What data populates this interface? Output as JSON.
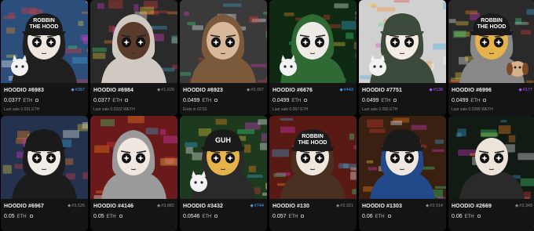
{
  "listing": {
    "cards": [
      {
        "name": "HOODIO #6983",
        "rank": "#367",
        "rank_style": "hl",
        "price": "0.0377",
        "currency": "ETH",
        "sub": "Last sale 0.031 ETH",
        "art": {
          "bg": "#2c4e7a",
          "skin": "#f0e6e0",
          "cap": "#1a1a1a",
          "hood": "#202020",
          "capText": "ROBBIN THE HOOD",
          "pet": "cat"
        }
      },
      {
        "name": "HOODIO #6984",
        "rank": "#1,626",
        "rank_style": "",
        "price": "0.0377",
        "currency": "ETH",
        "sub": "Last sale 0.0322 WETH",
        "art": {
          "bg": "#2a2a2a",
          "skin": "#5a3a2a",
          "cap": "",
          "hood": "#cfc9c2",
          "capText": "",
          "pet": ""
        }
      },
      {
        "name": "HOODIO #6923",
        "rank": "#3,097",
        "rank_style": "",
        "price": "0.0499",
        "currency": "ETH",
        "sub": "Ends in 02:52",
        "art": {
          "bg": "#3a3a3a",
          "skin": "#d9b89a",
          "cap": "",
          "hood": "#7a5a3a",
          "capText": "",
          "pet": ""
        }
      },
      {
        "name": "HOODIO #6676",
        "rank": "#443",
        "rank_style": "hl",
        "price": "0.0499",
        "currency": "ETH",
        "sub": "Last sale 0.057 ETH",
        "art": {
          "bg": "#0e2a12",
          "skin": "#eeeae6",
          "cap": "",
          "hood": "#2f6a35",
          "capText": "",
          "pet": "cat"
        }
      },
      {
        "name": "HOODIO #7751",
        "rank": "#138",
        "rank_style": "purple",
        "price": "0.0499",
        "currency": "ETH",
        "sub": "Last sale 0.055 ETH",
        "art": {
          "bg": "#d0d0d0",
          "skin": "#f4ece4",
          "cap": "#3b4a3a",
          "hood": "#3b4a3a",
          "capText": "",
          "pet": "cat"
        }
      },
      {
        "name": "HOODIO #6996",
        "rank": "#177",
        "rank_style": "purple",
        "price": "0.0499",
        "currency": "ETH",
        "sub": "Last sale 0.0289 WETH",
        "art": {
          "bg": "#2a2a2a",
          "skin": "#e6b34a",
          "cap": "#1a1a1a",
          "hood": "#888888",
          "capText": "ROBBIN THE HOOD",
          "pet": "dog"
        }
      },
      {
        "name": "HOODIO #6967",
        "rank": "#3,526",
        "rank_style": "",
        "price": "0.05",
        "currency": "ETH",
        "sub": "",
        "art": {
          "bg": "#24324e",
          "skin": "#f0ebe6",
          "cap": "#1a1a1a",
          "hood": "#1c1c1c",
          "capText": "",
          "pet": ""
        }
      },
      {
        "name": "HOODIO #4146",
        "rank": "#3,882",
        "rank_style": "",
        "price": "0.05",
        "currency": "ETH",
        "sub": "",
        "art": {
          "bg": "#6a1a1a",
          "skin": "#f0e8e0",
          "cap": "",
          "hood": "#9a9a9a",
          "capText": "",
          "pet": ""
        }
      },
      {
        "name": "HOODIO #3432",
        "rank": "#744",
        "rank_style": "hl",
        "price": "0.0546",
        "currency": "ETH",
        "sub": "",
        "art": {
          "bg": "#1e3a1e",
          "skin": "#e6b34a",
          "cap": "#1a1a1a",
          "hood": "#2a2a2a",
          "capText": "GUH",
          "pet": "cat"
        }
      },
      {
        "name": "HOODIO #130",
        "rank": "#3,921",
        "rank_style": "",
        "price": "0.057",
        "currency": "ETH",
        "sub": "",
        "art": {
          "bg": "#5a1a14",
          "skin": "#efe6de",
          "cap": "#1a1a1a",
          "hood": "#4a3020",
          "capText": "ROBBIN THE HOOD",
          "pet": ""
        }
      },
      {
        "name": "HOODIO #1303",
        "rank": "#3,014",
        "rank_style": "",
        "price": "0.06",
        "currency": "ETH",
        "sub": "",
        "art": {
          "bg": "#3a2010",
          "skin": "#f0e8e0",
          "cap": "#1a1a1a",
          "hood": "#224a8a",
          "capText": "",
          "pet": ""
        }
      },
      {
        "name": "HOODIO #2669",
        "rank": "#3,349",
        "rank_style": "",
        "price": "0.06",
        "currency": "ETH",
        "sub": "",
        "art": {
          "bg": "#121a14",
          "skin": "#ece4da",
          "cap": "",
          "hood": "",
          "capText": "",
          "pet": ""
        }
      }
    ]
  }
}
